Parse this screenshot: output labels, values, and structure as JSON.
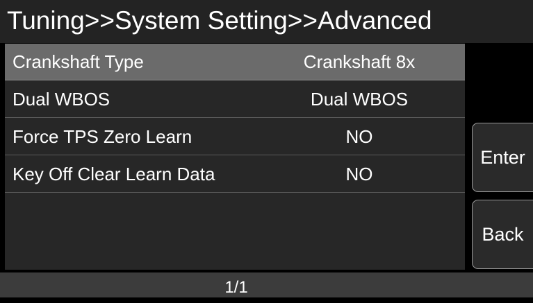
{
  "header": {
    "breadcrumb": "Tuning>>System Setting>>Advanced"
  },
  "settings": [
    {
      "label": "Crankshaft Type",
      "value": "Crankshaft 8x",
      "selected": true
    },
    {
      "label": "Dual WBOS",
      "value": "Dual WBOS",
      "selected": false
    },
    {
      "label": "Force TPS Zero Learn",
      "value": "NO",
      "selected": false
    },
    {
      "label": "Key Off Clear Learn Data",
      "value": "NO",
      "selected": false
    }
  ],
  "buttons": {
    "enter_label": "Enter",
    "back_label": "Back"
  },
  "footer": {
    "page": "1/1"
  },
  "colors": {
    "background": "#000000",
    "panel": "#272727",
    "selected_row": "#6b6b6b",
    "footer": "#3c3c3c",
    "text": "#ffffff"
  }
}
